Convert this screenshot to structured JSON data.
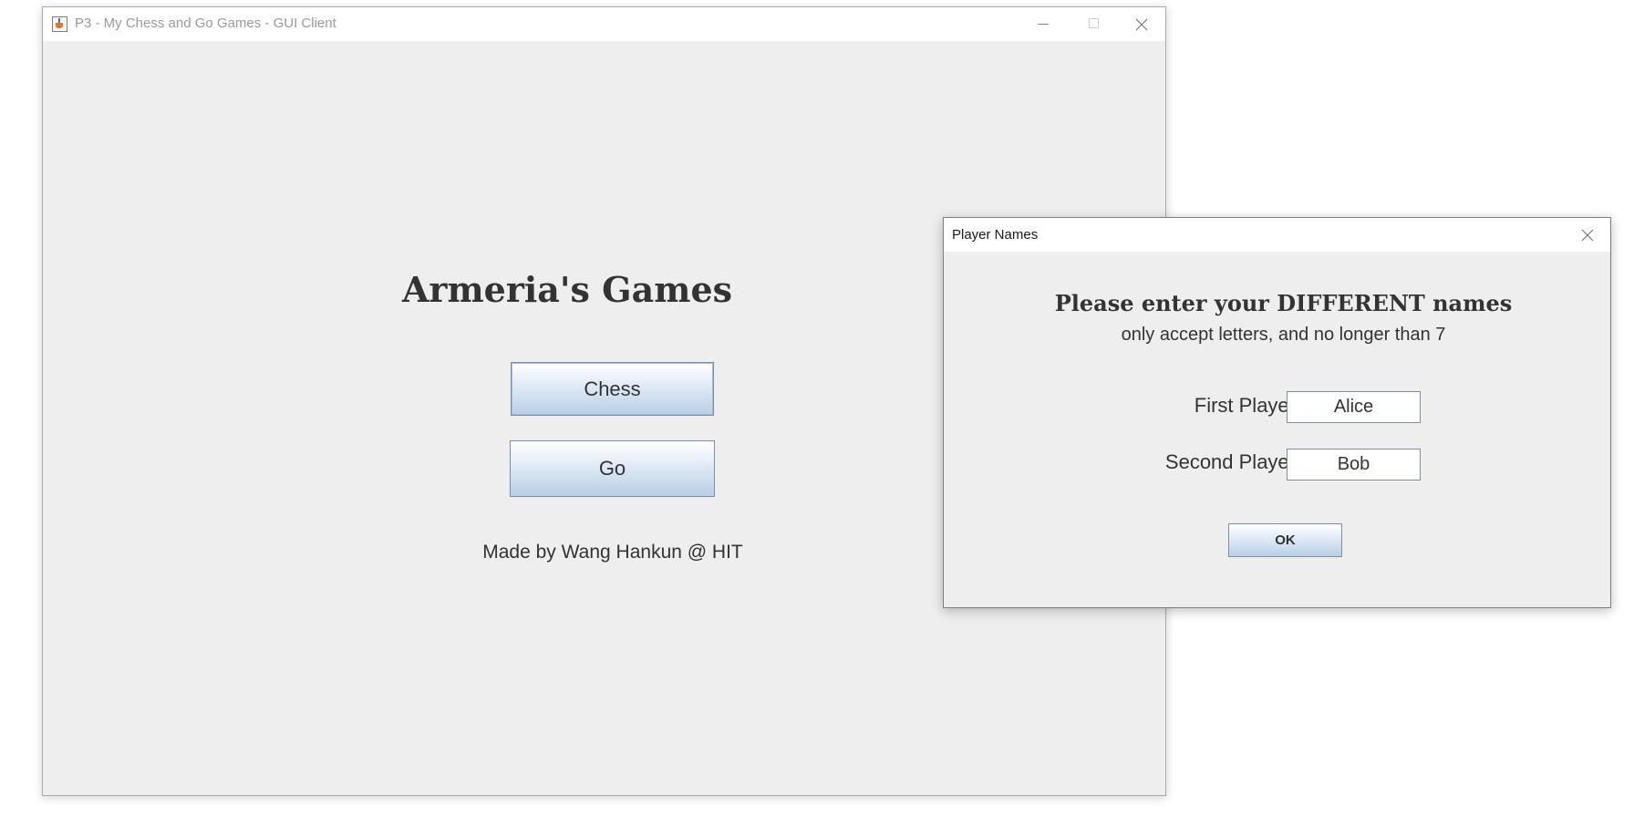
{
  "main_window": {
    "title": "P3 - My Chess and Go Games - GUI Client",
    "heading": "Armeria's Games",
    "buttons": {
      "chess": "Chess",
      "go": "Go"
    },
    "credit": "Made by Wang Hankun @ HIT"
  },
  "dialog": {
    "title": "Player Names",
    "heading": "Please enter your DIFFERENT names",
    "subheading": "only accept letters, and no longer than 7",
    "first_player_label": "First Player",
    "first_player_value": "Alice",
    "second_player_label": "Second Player",
    "second_player_value": "Bob",
    "ok_label": "OK"
  },
  "icons": {
    "app": "java-app-icon",
    "minimize": "minimize-icon",
    "maximize": "maximize-icon",
    "close": "close-icon"
  },
  "colors": {
    "window_bg": "#eeeeee",
    "button_gradient_top": "#ffffff",
    "button_gradient_bottom": "#b8cfe5",
    "button_border": "#7a8fae",
    "text": "#333333"
  }
}
